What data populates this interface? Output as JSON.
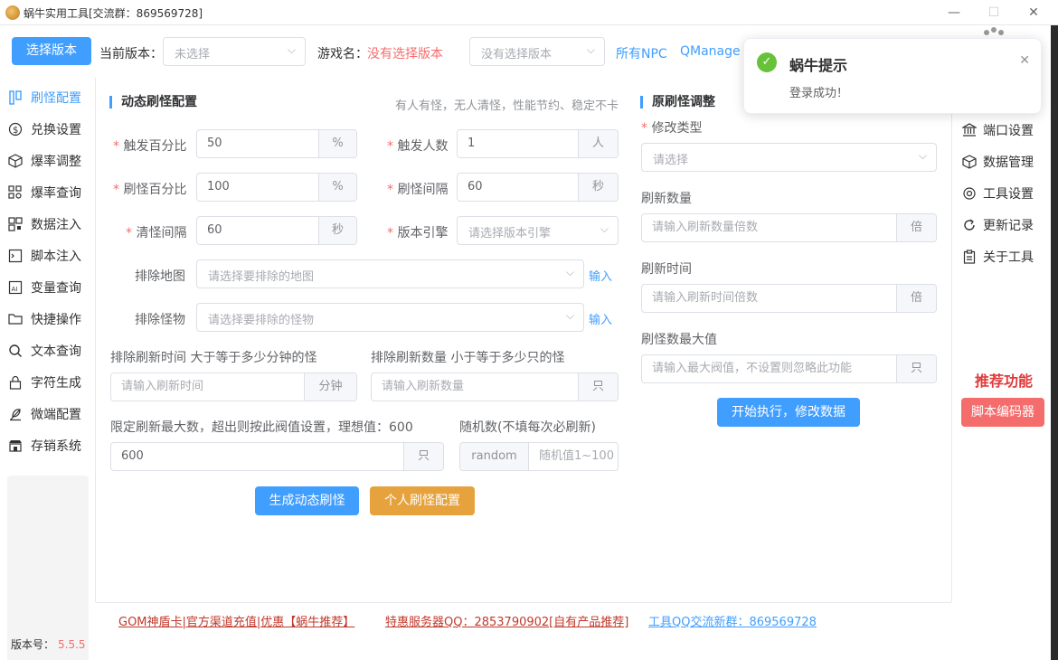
{
  "window": {
    "title": "蜗牛实用工具[交流群：869569728]"
  },
  "topbar": {
    "select_version_btn": "选择版本",
    "current_version_label": "当前版本：",
    "current_version_placeholder": "未选择",
    "game_name_label": "游戏名：",
    "game_name_value": "没有选择版本",
    "version_select_placeholder": "没有选择版本",
    "link_npc": "所有NPC",
    "link_qmanage": "QManage"
  },
  "sidebar": {
    "items": [
      {
        "label": "刷怪配置",
        "icon": "settings-icon"
      },
      {
        "label": "兑换设置",
        "icon": "dollar-icon"
      },
      {
        "label": "爆率调整",
        "icon": "box-icon"
      },
      {
        "label": "爆率查询",
        "icon": "grid-search-icon"
      },
      {
        "label": "数据注入",
        "icon": "qr-icon"
      },
      {
        "label": "脚本注入",
        "icon": "script-icon"
      },
      {
        "label": "变量查询",
        "icon": "variable-icon"
      },
      {
        "label": "快捷操作",
        "icon": "folder-icon"
      },
      {
        "label": "文本查询",
        "icon": "search-icon"
      },
      {
        "label": "字符生成",
        "icon": "lock-icon"
      },
      {
        "label": "微端配置",
        "icon": "feather-icon"
      },
      {
        "label": "存销系统",
        "icon": "store-icon"
      }
    ]
  },
  "dynamic": {
    "title": "动态刷怪配置",
    "hint": "有人有怪，无人清怪，性能节约、稳定不卡",
    "trigger_percent_label": "触发百分比",
    "trigger_percent_value": "50",
    "trigger_percent_suffix": "%",
    "trigger_people_label": "触发人数",
    "trigger_people_value": "1",
    "trigger_people_suffix": "人",
    "spawn_percent_label": "刷怪百分比",
    "spawn_percent_value": "100",
    "spawn_percent_suffix": "%",
    "spawn_interval_label": "刷怪间隔",
    "spawn_interval_value": "60",
    "spawn_interval_suffix": "秒",
    "clear_interval_label": "清怪间隔",
    "clear_interval_value": "60",
    "clear_interval_suffix": "秒",
    "engine_label": "版本引擎",
    "engine_placeholder": "请选择版本引擎",
    "exclude_map_label": "排除地图",
    "exclude_map_placeholder": "请选择要排除的地图",
    "exclude_map_input": "输入",
    "exclude_monster_label": "排除怪物",
    "exclude_monster_placeholder": "请选择要排除的怪物",
    "exclude_monster_input": "输入",
    "exclude_time_label": "排除刷新时间 大于等于多少分钟的怪",
    "exclude_time_placeholder": "请输入刷新时间",
    "exclude_time_suffix": "分钟",
    "exclude_count_label": "排除刷新数量 小于等于多少只的怪",
    "exclude_count_placeholder": "请输入刷新数量",
    "exclude_count_suffix": "只",
    "limit_label": "限定刷新最大数，超出则按此阀值设置，理想值：600",
    "limit_value": "600",
    "limit_suffix": "只",
    "random_label": "随机数(不填每次必刷新)",
    "random_prefix": "random",
    "random_placeholder": "随机值1~100",
    "generate_btn": "生成动态刷怪",
    "personal_btn": "个人刷怪配置"
  },
  "original": {
    "title": "原刷怪调整",
    "modify_type_label": "修改类型",
    "modify_type_placeholder": "请选择",
    "refresh_count_label": "刷新数量",
    "refresh_count_placeholder": "请输入刷新数量倍数",
    "refresh_count_suffix": "倍",
    "refresh_time_label": "刷新时间",
    "refresh_time_placeholder": "请输入刷新时间倍数",
    "refresh_time_suffix": "倍",
    "max_label": "刷怪数最大值",
    "max_placeholder": "请输入最大阀值，不设置则忽略此功能",
    "max_suffix": "只",
    "execute_btn": "开始执行，修改数据"
  },
  "right_sidebar": {
    "items": [
      {
        "label": "端口设置",
        "icon": "bank-icon"
      },
      {
        "label": "数据管理",
        "icon": "box-icon"
      },
      {
        "label": "工具设置",
        "icon": "gear-icon"
      },
      {
        "label": "更新记录",
        "icon": "refresh-icon"
      },
      {
        "label": "关于工具",
        "icon": "clipboard-icon"
      }
    ],
    "recommend_title": "推荐功能",
    "script_editor_btn": "脚本编码器"
  },
  "footer": {
    "link1": "GOM神盾卡|官方渠道充值|优惠【蜗牛推荐】",
    "link2": "特惠服务器QQ：2853790902[自有产品推荐]",
    "link3": "工具QQ交流新群：869569728"
  },
  "version": {
    "label": "版本号：",
    "number": "5.5.5"
  },
  "toast": {
    "title": "蜗牛提示",
    "message": "登录成功！"
  },
  "colors": {
    "primary": "#409eff",
    "danger": "#f56c6c",
    "warning": "#e6a23c",
    "success": "#67c23a"
  }
}
